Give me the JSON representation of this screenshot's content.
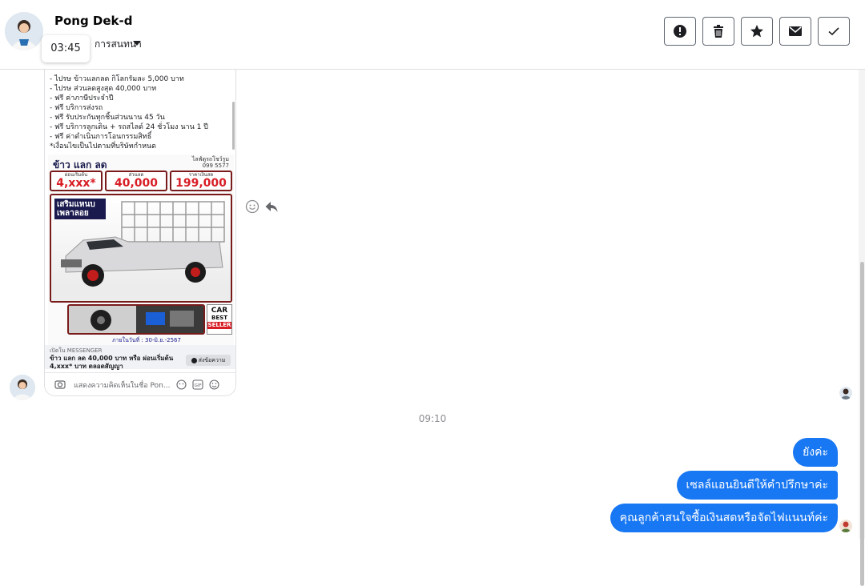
{
  "header": {
    "contact_name": "Pong Dek-d",
    "conversation_label": "การสนทนา",
    "tooltip_time": "03:45",
    "actions": [
      {
        "name": "report-button",
        "icon": "alert-circle-icon"
      },
      {
        "name": "delete-button",
        "icon": "trash-icon"
      },
      {
        "name": "star-button",
        "icon": "star-icon"
      },
      {
        "name": "mark-unread-button",
        "icon": "envelope-icon"
      },
      {
        "name": "done-button",
        "icon": "checkmark-icon"
      }
    ]
  },
  "shared_post": {
    "text_lines": [
      "- ไปรษ ข้าวแลกลด กิโลกรัมละ 5,000 บาท",
      "- ไปรษ ส่วนลดสูงสุด 40,000 บาท",
      "- ฟรี ค่าภาษีประจำปี",
      "- ฟรี บริการส่งรถ",
      "- ฟรี รับประกันทุกชิ้นส่วนนาน 45 วัน",
      "- ฟรี บริการลูกเดิน + รถสไลด์ 24 ชั่วโมง นาน 1 ปี",
      "- ฟรี ค่าดำเนินการโอนกรรมสิทธิ์",
      "*เงื่อนไขเป็นไปตามที่บริษัทกำหนด"
    ],
    "ad": {
      "title": "ข้าว แลก ลด",
      "phone": "ไลฟ์ดูรถโชว์รูม 099 5577",
      "boxes": [
        {
          "caption": "ผ่อนเริ่มต้น",
          "value": "4,xxx*"
        },
        {
          "caption": "ส่วนลด",
          "value": "40,000"
        },
        {
          "caption": "ราคาเงินสด",
          "value": "199,000"
        }
      ],
      "banner": "เสริมแหนบ เพลาลอย",
      "logo_lines": [
        "CAR",
        "BEST",
        "SELLER"
      ],
      "date_text": "ภายในวันที่ : 30-มิ.ย.-2567"
    },
    "open_in": "เปิดใน MESSENGER",
    "caption": "ข้าว แลก ลด 40,000 บาท หรือ ผ่อนเริ่มต้น 4,xxx* บาท ตลอดสัญญา",
    "send_button": "ส่งข้อความ",
    "composer_placeholder": "แสดงความคิดเห็นในชื่อ Pon..."
  },
  "time_separator": "09:10",
  "messages": [
    {
      "text": "ยังค่ะ"
    },
    {
      "text": "เซลล์แอนยินดีให้คำปรึกษาค่ะ"
    },
    {
      "text": "คุณลูกค้าสนใจซื้อเงินสดหรือจัดไฟแนนท์ค่ะ"
    }
  ],
  "colors": {
    "bubble_blue": "#1877f2",
    "ad_red": "#d81d25",
    "ad_frame": "#7a1b1b"
  }
}
